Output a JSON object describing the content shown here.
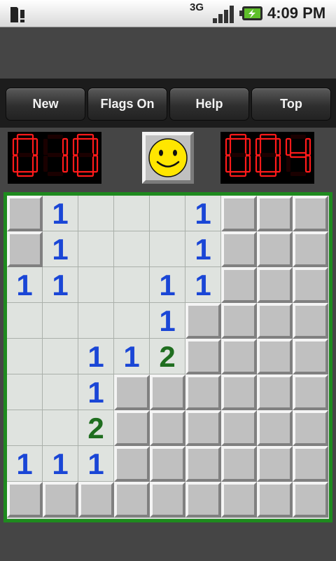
{
  "status_bar": {
    "network": "3G",
    "time": "4:09 PM"
  },
  "toolbar": {
    "new_label": "New",
    "flags_label": "Flags On",
    "help_label": "Help",
    "top_label": "Top"
  },
  "counters": {
    "mines_remaining": "010",
    "timer": "004",
    "led_color": "#ff1a1a"
  },
  "face": {
    "icon": "smiley-face-icon",
    "color": "#ffe600"
  },
  "board": {
    "rows": 9,
    "cols": 9,
    "legend": "H = hidden cell, E = opened empty cell, digit = opened cell with adjacent mine count",
    "cells": [
      [
        "H",
        "1",
        "E",
        "E",
        "E",
        "1",
        "H",
        "H",
        "H"
      ],
      [
        "H",
        "1",
        "E",
        "E",
        "E",
        "1",
        "H",
        "H",
        "H"
      ],
      [
        "1",
        "1",
        "E",
        "E",
        "1",
        "1",
        "H",
        "H",
        "H"
      ],
      [
        "E",
        "E",
        "E",
        "E",
        "1",
        "H",
        "H",
        "H",
        "H"
      ],
      [
        "E",
        "E",
        "1",
        "1",
        "2",
        "H",
        "H",
        "H",
        "H"
      ],
      [
        "E",
        "E",
        "1",
        "H",
        "H",
        "H",
        "H",
        "H",
        "H"
      ],
      [
        "E",
        "E",
        "2",
        "H",
        "H",
        "H",
        "H",
        "H",
        "H"
      ],
      [
        "1",
        "1",
        "1",
        "H",
        "H",
        "H",
        "H",
        "H",
        "H"
      ],
      [
        "H",
        "H",
        "H",
        "H",
        "H",
        "H",
        "H",
        "H",
        "H"
      ]
    ],
    "number_colors": {
      "1": "#1a46d6",
      "2": "#1f6e1f"
    }
  }
}
